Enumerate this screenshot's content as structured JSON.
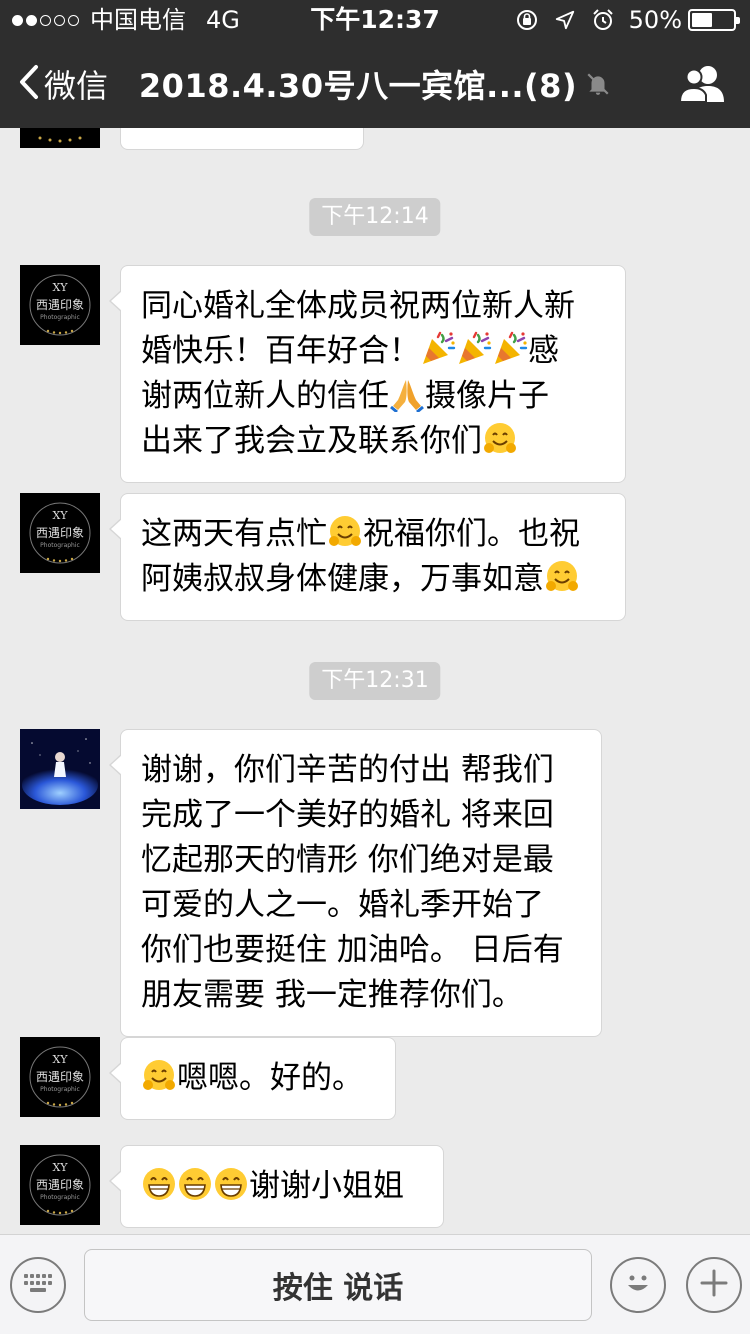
{
  "status_bar": {
    "carrier": "中国电信",
    "network": "4G",
    "time": "下午12:37",
    "battery": "50%",
    "battery_level": 0.5
  },
  "nav": {
    "back_label": "微信",
    "title": "2018.4.30号八一宾馆...(8)"
  },
  "messages": [
    {
      "time": "下午12:14",
      "sender": "xy",
      "lines": [
        [
          "同心婚礼全体成员祝两位新人新"
        ],
        [
          "婚快乐！百年好合！",
          "[party]",
          "[party]",
          "[party]",
          "感"
        ],
        [
          "谢两位新人的信任",
          "[pray]",
          "摄像片子"
        ],
        [
          "出来了我会立及联系你们",
          "[hug]"
        ]
      ]
    },
    {
      "sender": "xy",
      "lines": [
        [
          "这两天有点忙",
          "[hug]",
          "祝福你们。也祝"
        ],
        [
          "阿姨叔叔身体健康，万事如意",
          "[hug]"
        ]
      ]
    },
    {
      "time": "下午12:31",
      "sender": "bride",
      "lines": [
        [
          "谢谢，你们辛苦的付出 帮我们"
        ],
        [
          "完成了一个美好的婚礼 将来回"
        ],
        [
          "忆起那天的情形 你们绝对是最"
        ],
        [
          "可爱的人之一。婚礼季开始了"
        ],
        [
          "你们也要挺住 加油哈。 日后有"
        ],
        [
          "朋友需要 我一定推荐你们。"
        ]
      ]
    },
    {
      "sender": "xy",
      "lines": [
        [
          "[hug]",
          "嗯嗯。好的。"
        ]
      ]
    },
    {
      "sender": "xy",
      "lines": [
        [
          "[grin]",
          "[grin]",
          "[grin]",
          "谢谢小姐姐"
        ]
      ]
    }
  ],
  "avatar_xy": {
    "logo": "XY",
    "name": "西遇印象",
    "sub": "Photographic"
  },
  "input_bar": {
    "hold_to_talk": "按住 说话"
  },
  "icons": {
    "back": "chevron-left-icon",
    "mute": "bell-off-icon",
    "members": "group-members-icon",
    "keyboard": "keyboard-icon",
    "emoji": "smiley-icon",
    "more": "plus-icon"
  },
  "colors": {
    "nav_background": "#2e2e2e",
    "chat_background": "#ebebeb",
    "bubble": "#ffffff",
    "time_pill": "#cecece"
  }
}
